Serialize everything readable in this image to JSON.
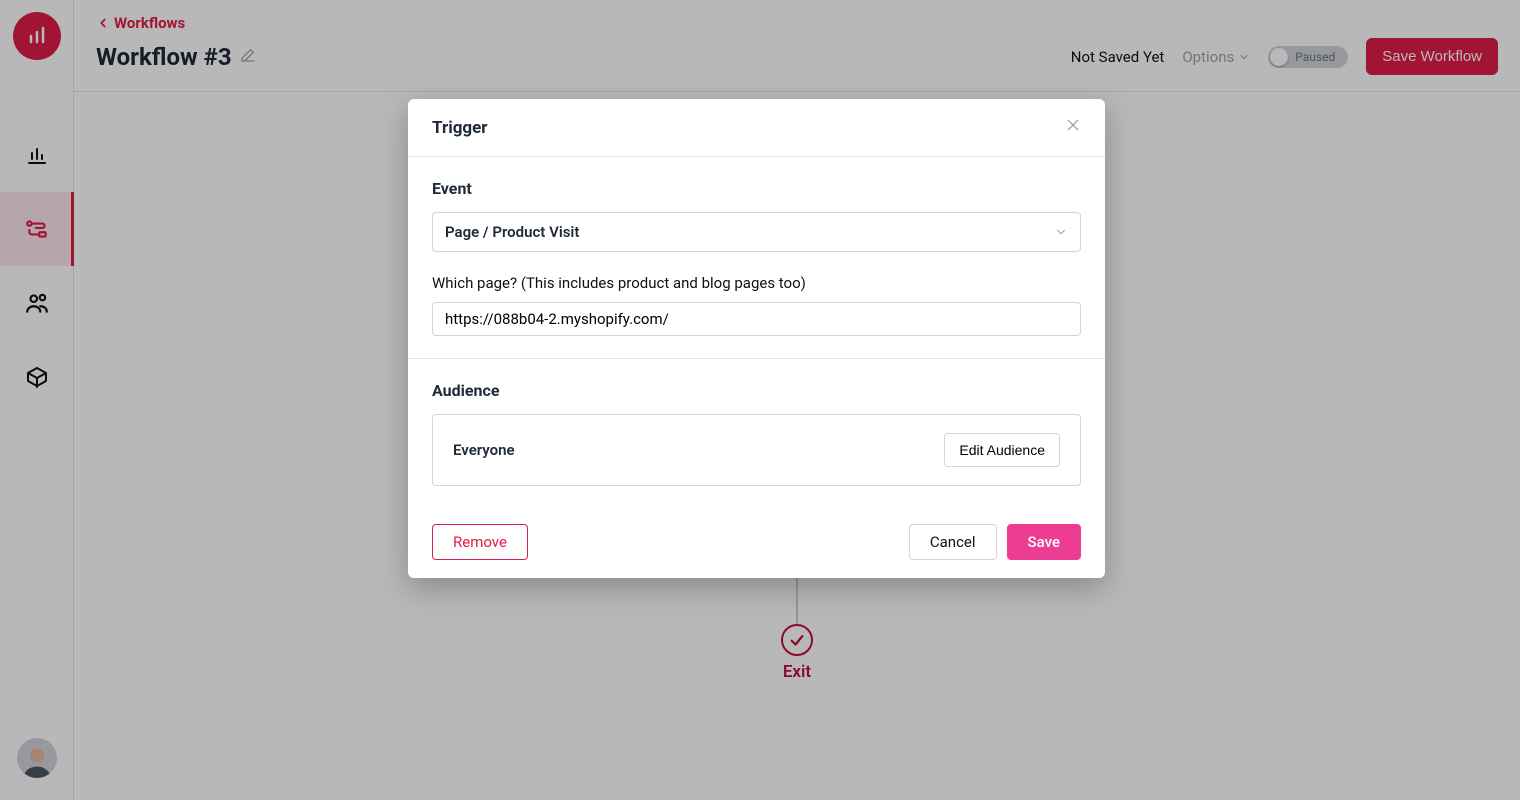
{
  "breadcrumb": {
    "back_label": "Workflows"
  },
  "title": "Workflow #3",
  "header": {
    "save_status": "Not Saved Yet",
    "options_label": "Options",
    "toggle_label": "Paused",
    "save_button": "Save Workflow"
  },
  "canvas": {
    "exit_label": "Exit"
  },
  "modal": {
    "title": "Trigger",
    "event": {
      "section_label": "Event",
      "selected": "Page / Product Visit",
      "page_question": "Which page? (This includes product and blog pages too)",
      "page_value": "https://088b04-2.myshopify.com/"
    },
    "audience": {
      "section_label": "Audience",
      "selected": "Everyone",
      "edit_button": "Edit Audience"
    },
    "footer": {
      "remove": "Remove",
      "cancel": "Cancel",
      "save": "Save"
    }
  }
}
